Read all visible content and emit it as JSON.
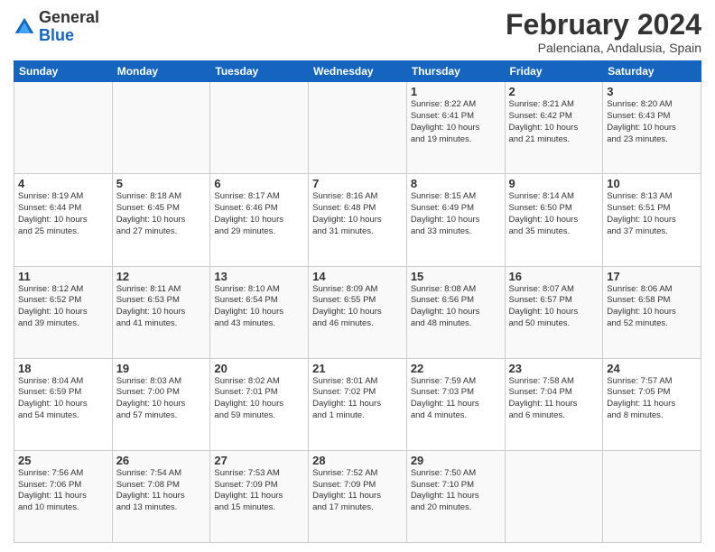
{
  "header": {
    "logo": {
      "general": "General",
      "blue": "Blue"
    },
    "title": "February 2024",
    "location": "Palenciana, Andalusia, Spain"
  },
  "days_of_week": [
    "Sunday",
    "Monday",
    "Tuesday",
    "Wednesday",
    "Thursday",
    "Friday",
    "Saturday"
  ],
  "weeks": [
    [
      {
        "day": "",
        "info": ""
      },
      {
        "day": "",
        "info": ""
      },
      {
        "day": "",
        "info": ""
      },
      {
        "day": "",
        "info": ""
      },
      {
        "day": "1",
        "info": "Sunrise: 8:22 AM\nSunset: 6:41 PM\nDaylight: 10 hours\nand 19 minutes."
      },
      {
        "day": "2",
        "info": "Sunrise: 8:21 AM\nSunset: 6:42 PM\nDaylight: 10 hours\nand 21 minutes."
      },
      {
        "day": "3",
        "info": "Sunrise: 8:20 AM\nSunset: 6:43 PM\nDaylight: 10 hours\nand 23 minutes."
      }
    ],
    [
      {
        "day": "4",
        "info": "Sunrise: 8:19 AM\nSunset: 6:44 PM\nDaylight: 10 hours\nand 25 minutes."
      },
      {
        "day": "5",
        "info": "Sunrise: 8:18 AM\nSunset: 6:45 PM\nDaylight: 10 hours\nand 27 minutes."
      },
      {
        "day": "6",
        "info": "Sunrise: 8:17 AM\nSunset: 6:46 PM\nDaylight: 10 hours\nand 29 minutes."
      },
      {
        "day": "7",
        "info": "Sunrise: 8:16 AM\nSunset: 6:48 PM\nDaylight: 10 hours\nand 31 minutes."
      },
      {
        "day": "8",
        "info": "Sunrise: 8:15 AM\nSunset: 6:49 PM\nDaylight: 10 hours\nand 33 minutes."
      },
      {
        "day": "9",
        "info": "Sunrise: 8:14 AM\nSunset: 6:50 PM\nDaylight: 10 hours\nand 35 minutes."
      },
      {
        "day": "10",
        "info": "Sunrise: 8:13 AM\nSunset: 6:51 PM\nDaylight: 10 hours\nand 37 minutes."
      }
    ],
    [
      {
        "day": "11",
        "info": "Sunrise: 8:12 AM\nSunset: 6:52 PM\nDaylight: 10 hours\nand 39 minutes."
      },
      {
        "day": "12",
        "info": "Sunrise: 8:11 AM\nSunset: 6:53 PM\nDaylight: 10 hours\nand 41 minutes."
      },
      {
        "day": "13",
        "info": "Sunrise: 8:10 AM\nSunset: 6:54 PM\nDaylight: 10 hours\nand 43 minutes."
      },
      {
        "day": "14",
        "info": "Sunrise: 8:09 AM\nSunset: 6:55 PM\nDaylight: 10 hours\nand 46 minutes."
      },
      {
        "day": "15",
        "info": "Sunrise: 8:08 AM\nSunset: 6:56 PM\nDaylight: 10 hours\nand 48 minutes."
      },
      {
        "day": "16",
        "info": "Sunrise: 8:07 AM\nSunset: 6:57 PM\nDaylight: 10 hours\nand 50 minutes."
      },
      {
        "day": "17",
        "info": "Sunrise: 8:06 AM\nSunset: 6:58 PM\nDaylight: 10 hours\nand 52 minutes."
      }
    ],
    [
      {
        "day": "18",
        "info": "Sunrise: 8:04 AM\nSunset: 6:59 PM\nDaylight: 10 hours\nand 54 minutes."
      },
      {
        "day": "19",
        "info": "Sunrise: 8:03 AM\nSunset: 7:00 PM\nDaylight: 10 hours\nand 57 minutes."
      },
      {
        "day": "20",
        "info": "Sunrise: 8:02 AM\nSunset: 7:01 PM\nDaylight: 10 hours\nand 59 minutes."
      },
      {
        "day": "21",
        "info": "Sunrise: 8:01 AM\nSunset: 7:02 PM\nDaylight: 11 hours\nand 1 minute."
      },
      {
        "day": "22",
        "info": "Sunrise: 7:59 AM\nSunset: 7:03 PM\nDaylight: 11 hours\nand 4 minutes."
      },
      {
        "day": "23",
        "info": "Sunrise: 7:58 AM\nSunset: 7:04 PM\nDaylight: 11 hours\nand 6 minutes."
      },
      {
        "day": "24",
        "info": "Sunrise: 7:57 AM\nSunset: 7:05 PM\nDaylight: 11 hours\nand 8 minutes."
      }
    ],
    [
      {
        "day": "25",
        "info": "Sunrise: 7:56 AM\nSunset: 7:06 PM\nDaylight: 11 hours\nand 10 minutes."
      },
      {
        "day": "26",
        "info": "Sunrise: 7:54 AM\nSunset: 7:08 PM\nDaylight: 11 hours\nand 13 minutes."
      },
      {
        "day": "27",
        "info": "Sunrise: 7:53 AM\nSunset: 7:09 PM\nDaylight: 11 hours\nand 15 minutes."
      },
      {
        "day": "28",
        "info": "Sunrise: 7:52 AM\nSunset: 7:09 PM\nDaylight: 11 hours\nand 17 minutes."
      },
      {
        "day": "29",
        "info": "Sunrise: 7:50 AM\nSunset: 7:10 PM\nDaylight: 11 hours\nand 20 minutes."
      },
      {
        "day": "",
        "info": ""
      },
      {
        "day": "",
        "info": ""
      }
    ]
  ]
}
